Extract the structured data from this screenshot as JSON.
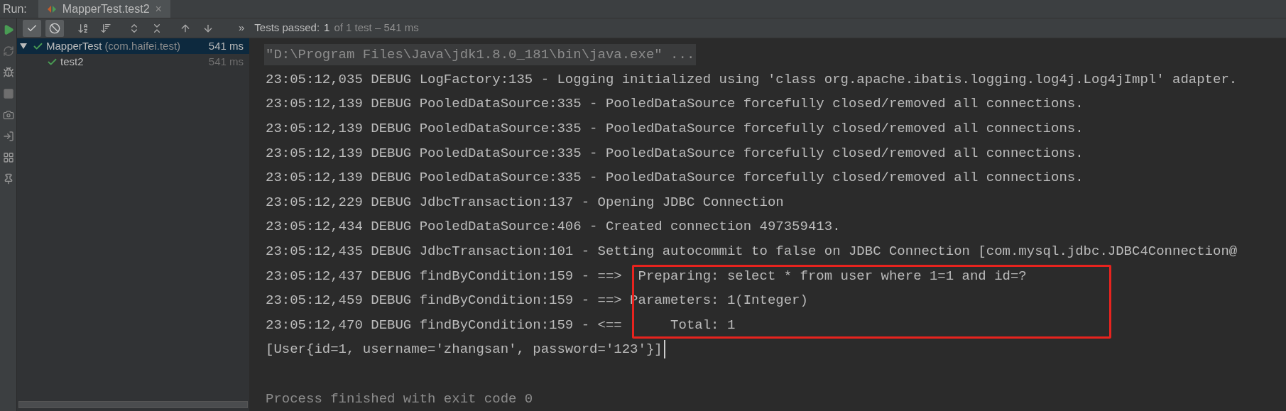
{
  "run_label": "Run:",
  "run_tab": {
    "title": "MapperTest.test2",
    "close": "×"
  },
  "toolbar": {
    "buttons": [
      {
        "kind": "check",
        "selected": true
      },
      {
        "kind": "ignored",
        "selected": true
      },
      {
        "kind": "sort-alpha",
        "selected": false
      },
      {
        "kind": "sort-duration",
        "selected": false
      },
      {
        "kind": "expand",
        "selected": false
      },
      {
        "kind": "collapse",
        "selected": false
      },
      {
        "kind": "up",
        "selected": false
      },
      {
        "kind": "down",
        "selected": false
      }
    ],
    "more": "»",
    "status": {
      "label": "Tests passed:",
      "count": "1",
      "rest": "of 1 test – 541 ms"
    }
  },
  "side_tools": [
    {
      "kind": "run"
    },
    {
      "kind": "rerun"
    },
    {
      "kind": "toggle"
    },
    {
      "kind": "stop"
    },
    {
      "kind": "camera"
    },
    {
      "kind": "import"
    },
    {
      "kind": "layout"
    },
    {
      "kind": "pin"
    }
  ],
  "tree": [
    {
      "name": "MapperTest",
      "package": "(com.haifei.test)",
      "time": "541 ms",
      "passed": true,
      "selected": true,
      "children": [
        {
          "name": "test2",
          "time": "541 ms",
          "passed": true,
          "selected": false
        }
      ]
    }
  ],
  "console": [
    {
      "kind": "command",
      "text": "\"D:\\Program Files\\Java\\jdk1.8.0_181\\bin\\java.exe\" ...",
      "highlighted": false
    },
    {
      "kind": "log",
      "text": "23:05:12,035 DEBUG LogFactory:135 - Logging initialized using 'class org.apache.ibatis.logging.log4j.Log4jImpl' adapter.",
      "highlighted": false
    },
    {
      "kind": "log",
      "text": "23:05:12,139 DEBUG PooledDataSource:335 - PooledDataSource forcefully closed/removed all connections.",
      "highlighted": false
    },
    {
      "kind": "log",
      "text": "23:05:12,139 DEBUG PooledDataSource:335 - PooledDataSource forcefully closed/removed all connections.",
      "highlighted": false
    },
    {
      "kind": "log",
      "text": "23:05:12,139 DEBUG PooledDataSource:335 - PooledDataSource forcefully closed/removed all connections.",
      "highlighted": false
    },
    {
      "kind": "log",
      "text": "23:05:12,139 DEBUG PooledDataSource:335 - PooledDataSource forcefully closed/removed all connections.",
      "highlighted": false
    },
    {
      "kind": "log",
      "text": "23:05:12,229 DEBUG JdbcTransaction:137 - Opening JDBC Connection",
      "highlighted": false
    },
    {
      "kind": "log",
      "text": "23:05:12,434 DEBUG PooledDataSource:406 - Created connection 497359413.",
      "highlighted": false
    },
    {
      "kind": "log",
      "text": "23:05:12,435 DEBUG JdbcTransaction:101 - Setting autocommit to false on JDBC Connection [com.mysql.jdbc.JDBC4Connection@",
      "highlighted": false
    },
    {
      "kind": "log",
      "text": "23:05:12,437 DEBUG findByCondition:159 - ==>  Preparing: select * from user where 1=1 and id=?",
      "highlighted": true
    },
    {
      "kind": "log",
      "text": "23:05:12,459 DEBUG findByCondition:159 - ==> Parameters: 1(Integer)",
      "highlighted": true
    },
    {
      "kind": "log",
      "text": "23:05:12,470 DEBUG findByCondition:159 - <==      Total: 1",
      "highlighted": true
    },
    {
      "kind": "output",
      "text": "[User{id=1, username='zhangsan', password='123'}]",
      "cursor": true,
      "highlighted": false
    },
    {
      "kind": "blank",
      "highlighted": false
    },
    {
      "kind": "exit",
      "text": "Process finished with exit code 0",
      "highlighted": false
    }
  ]
}
